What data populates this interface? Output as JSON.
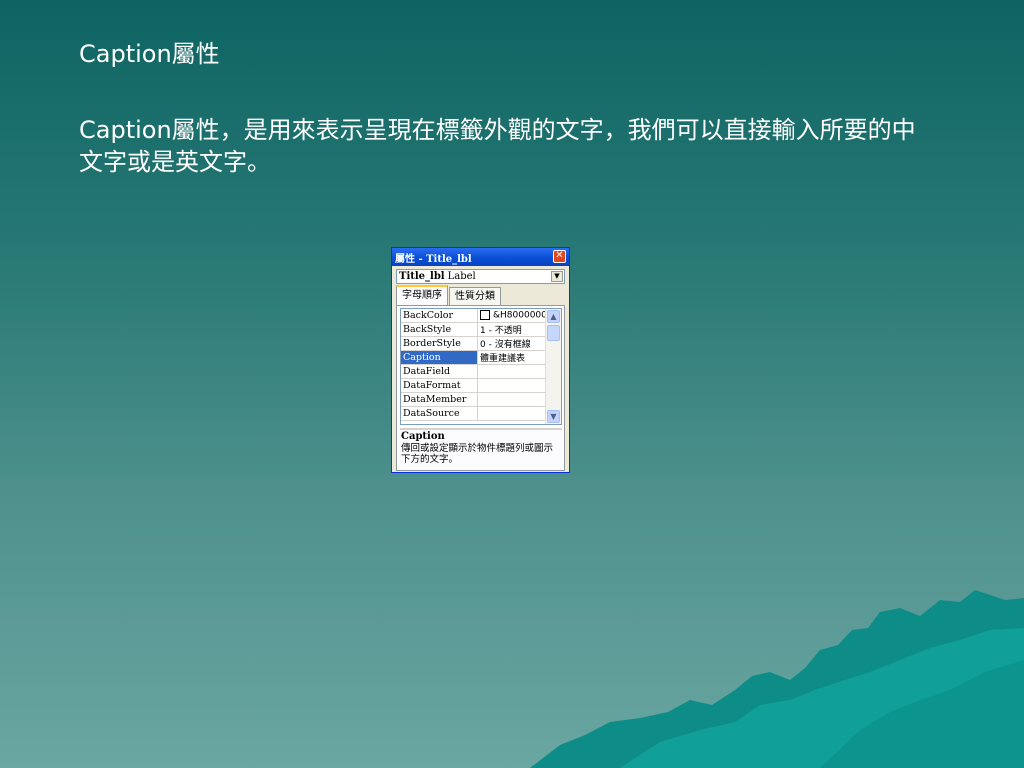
{
  "slide": {
    "title": "Caption屬性",
    "body": "Caption屬性，是用來表示呈現在標籤外觀的文字，我們可以直接輸入所要的中文字或是英文字。"
  },
  "properties_window": {
    "title": "屬性 - Title_lbl",
    "close_icon": "close-x-icon",
    "object_name": "Title_lbl",
    "object_type": "Label",
    "tabs": [
      "字母順序",
      "性質分類"
    ],
    "active_tab": "字母順序",
    "rows": [
      {
        "name": "BackColor",
        "value": "&H8000000"
      },
      {
        "name": "BackStyle",
        "value": "1 - 不透明"
      },
      {
        "name": "BorderStyle",
        "value": "0 - 沒有框線"
      },
      {
        "name": "Caption",
        "value": "體重建議表"
      },
      {
        "name": "DataField",
        "value": ""
      },
      {
        "name": "DataFormat",
        "value": ""
      },
      {
        "name": "DataMember",
        "value": ""
      },
      {
        "name": "DataSource",
        "value": ""
      }
    ],
    "selected_row": "Caption",
    "description_title": "Caption",
    "description_text": "傳回或設定顯示於物件標題列或圖示下方的文字。"
  },
  "colors": {
    "background_top": "#0d6462",
    "background_bottom": "#6aa6a2",
    "mountain": "#0e9a94",
    "titlebar": "#0a4fd6",
    "selection": "#316ac5"
  }
}
